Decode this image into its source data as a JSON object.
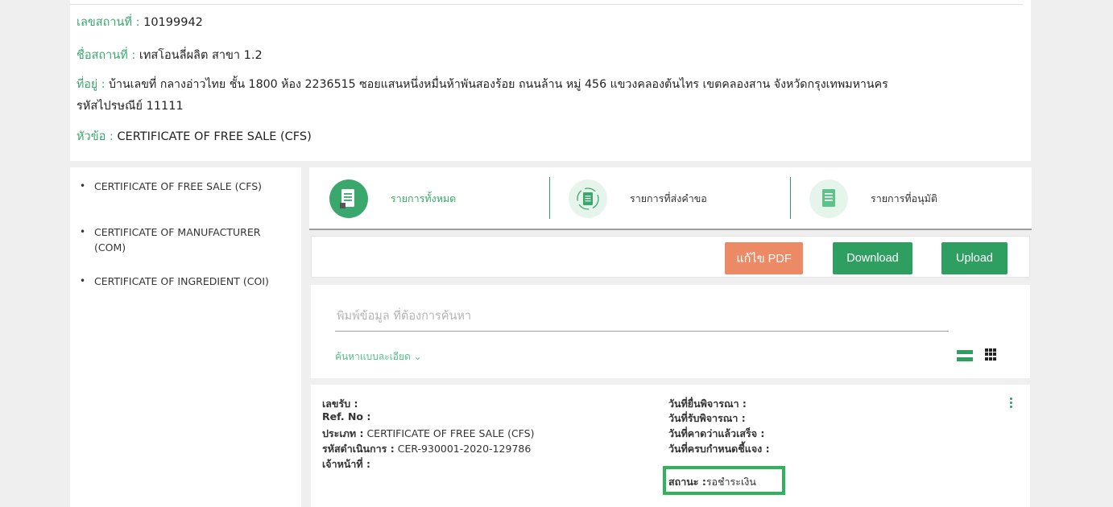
{
  "header": {
    "place_number_label": "เลขสถานที่ :",
    "place_number_value": "10199942",
    "place_name_label": "ชื่อสถานที่ :",
    "place_name_value": "เทสโอนลี่ผลิต สาขา 1.2",
    "address_label": "ที่อยู่ :",
    "address_value": "บ้านเลขที่ กลางอ่าวไทย ชั้น 1800 ห้อง 2236515 ซอยแสนหนึ่งหมื่นห้าพันสองร้อย ถนนล้าน หมู่ 456 แขวงคลองต้นไทร เขตคลองสาน จังหวัดกรุงเทพมหานคร",
    "postal_line": "รหัสไปรษณีย์ 11111",
    "topic_label": "หัวข้อ :",
    "topic_value": "CERTIFICATE OF FREE SALE (CFS)"
  },
  "sidebar": {
    "items": [
      {
        "label": "CERTIFICATE OF FREE SALE (CFS)"
      },
      {
        "label": "CERTIFICATE OF MANUFACTURER (COM)"
      },
      {
        "label": "CERTIFICATE OF INGREDIENT (COI)"
      }
    ]
  },
  "tabs": [
    {
      "label": "รายการทั้งหมด",
      "icon": "document-icon",
      "active": true
    },
    {
      "label": "รายการที่ส่งคำขอ",
      "icon": "document-refresh-icon",
      "active": false
    },
    {
      "label": "รายการที่อนุมัติ",
      "icon": "document-approved-icon",
      "active": false
    }
  ],
  "toolbar": {
    "edit_pdf_label": "แก้ไข PDF",
    "download_label": "Download",
    "upload_label": "Upload"
  },
  "search": {
    "placeholder": "พิมพ์ข้อมูล ที่ต้องการค้นหา",
    "advanced_label": "ค้นหาแบบละเอียด ⌄"
  },
  "record": {
    "left": [
      {
        "key": "เลขรับ :",
        "value": ""
      },
      {
        "key": "Ref. No :",
        "value": ""
      },
      {
        "key": "ประเภท :",
        "value": "CERTIFICATE OF FREE SALE (CFS)"
      },
      {
        "key": "รหัสดำเนินการ :",
        "value": "CER-930001-2020-129786"
      },
      {
        "key": "เจ้าหน้าที่ :",
        "value": ""
      }
    ],
    "right": [
      {
        "key": "วันที่ยื่นพิจารณา :",
        "value": ""
      },
      {
        "key": "วันที่รับพิจารณา :",
        "value": ""
      },
      {
        "key": "วันที่คาดว่าแล้วเสร็จ :",
        "value": ""
      },
      {
        "key": "วันที่ครบกำหนดชี้แจง :",
        "value": ""
      },
      {
        "key": "สถานะ :",
        "value": "รอชำระเงิน"
      }
    ]
  },
  "colors": {
    "accent_green": "#2f9e61",
    "label_green": "#3aa76d",
    "pdf_orange": "#ec8a66",
    "highlight_green": "#2fb45a"
  }
}
